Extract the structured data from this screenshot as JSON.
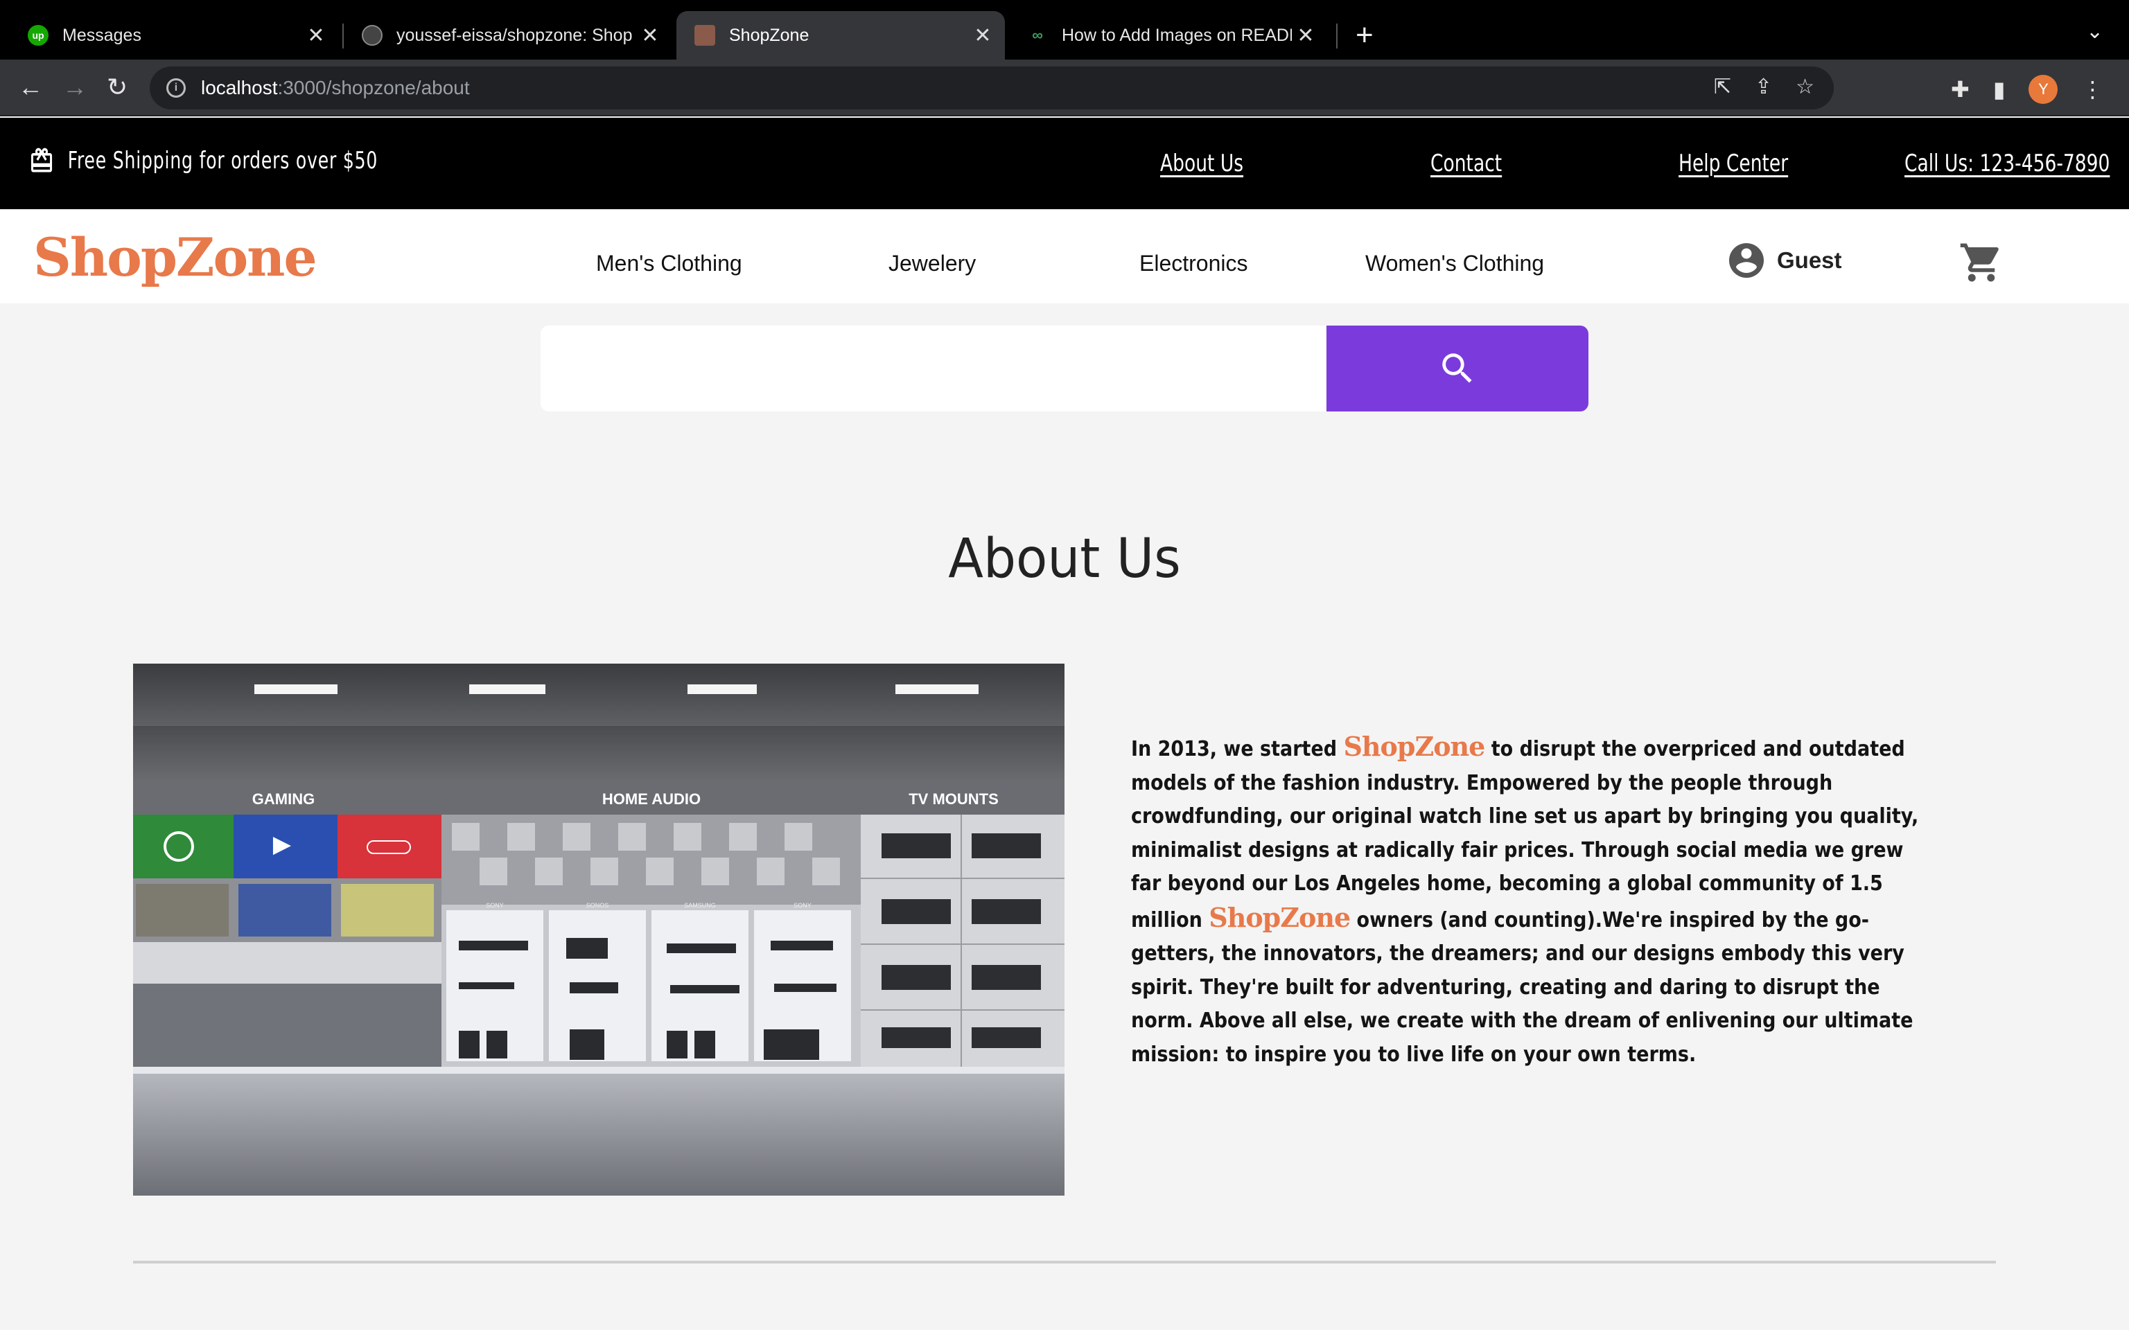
{
  "browser": {
    "tabs": [
      {
        "title": "Messages",
        "favicon": "upwork-icon",
        "active": false
      },
      {
        "title": "youssef-eissa/shopzone: Shop",
        "favicon": "github-icon",
        "active": false
      },
      {
        "title": "ShopZone",
        "favicon": "shopzone-favicon",
        "active": true
      },
      {
        "title": "How to Add Images on READM",
        "favicon": "link-icon",
        "active": false
      }
    ],
    "url_host": "localhost",
    "url_path": ":3000/shopzone/about",
    "profile_initial": "Y"
  },
  "topbar": {
    "promo": "Free Shipping for orders over $50",
    "links": [
      "About Us",
      "Contact",
      "Help Center",
      "Call Us: 123-456-7890"
    ]
  },
  "nav": {
    "logo": "ShopZone",
    "categories": [
      "Men's Clothing",
      "Jewelery",
      "Electronics",
      "Women's Clothing"
    ],
    "user_label": "Guest"
  },
  "search": {
    "placeholder": ""
  },
  "about": {
    "title": "About Us",
    "image_labels": [
      "GAMING",
      "HOME AUDIO",
      "TV MOUNTS"
    ],
    "image_small_labels": [
      "SONY",
      "SONOS",
      "SAMSUNG",
      "SONY"
    ],
    "brand": "ShopZone",
    "text_part1": "In 2013, we started ",
    "text_part2": " to disrupt the overpriced and outdated models of the fashion industry. Empowered by the people through crowdfunding, our original watch line set us apart by bringing you quality, minimalist designs at radically fair prices. Through social media we grew far beyond our Los Angeles home, becoming a global community of 1.5 million ",
    "text_part3": " owners (and counting).We're inspired by the go-getters, the innovators, the dreamers; and our designs embody this very spirit. They're built for adventuring, creating and daring to disrupt the norm. Above all else, we create with the dream of enlivening our ultimate mission: to inspire you to live life on your own terms."
  },
  "colors": {
    "brand": "#e8794a",
    "search_button": "#7b3bdc",
    "topbar": "#000000"
  }
}
